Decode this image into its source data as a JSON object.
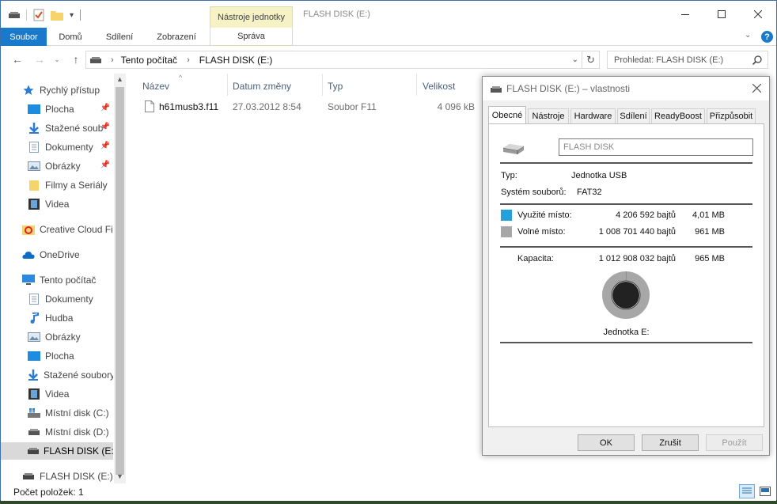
{
  "window": {
    "title": "FLASH DISK (E:)",
    "context_tab": "Nástroje jednotky"
  },
  "ribbon": {
    "tabs": [
      "Soubor",
      "Domů",
      "Sdílení",
      "Zobrazení"
    ],
    "context_subtab": "Správa"
  },
  "address": {
    "path": [
      "Tento počítač",
      "FLASH DISK (E:)"
    ],
    "search_placeholder": "Prohledat: FLASH DISK (E:)"
  },
  "nav": {
    "quick_access": "Rychlý přístup",
    "quick_items": [
      "Plocha",
      "Stažené soub",
      "Dokumenty",
      "Obrázky",
      "Filmy a Seriály",
      "Videa"
    ],
    "creative_cloud": "Creative Cloud Fil",
    "onedrive": "OneDrive",
    "this_pc": "Tento počítač",
    "pc_items": [
      "Dokumenty",
      "Hudba",
      "Obrázky",
      "Plocha",
      "Stažené soubory",
      "Videa",
      "Místní disk (C:)",
      "Místní disk (D:)",
      "FLASH DISK (E:)"
    ],
    "flash_disk": "FLASH DISK (E:)"
  },
  "columns": {
    "name": "Název",
    "date": "Datum změny",
    "type": "Typ",
    "size": "Velikost"
  },
  "files": [
    {
      "name": "h61musb3.f11",
      "date": "27.03.2012 8:54",
      "type": "Soubor F11",
      "size": "4 096 kB"
    }
  ],
  "status": {
    "items_count": "Počet položek: 1"
  },
  "properties": {
    "title": "FLASH DISK (E:) – vlastnosti",
    "tabs": [
      "Obecné",
      "Nástroje",
      "Hardware",
      "Sdílení",
      "ReadyBoost",
      "Přizpůsobit"
    ],
    "label_value": "FLASH DISK",
    "type_label": "Typ:",
    "type_value": "Jednotka USB",
    "fs_label": "Systém souborů:",
    "fs_value": "FAT32",
    "used_label": "Využité místo:",
    "used_bytes": "4 206 592 bajtů",
    "used_human": "4,01 MB",
    "free_label": "Volné místo:",
    "free_bytes": "1 008 701 440 bajtů",
    "free_human": "961 MB",
    "capacity_label": "Kapacita:",
    "capacity_bytes": "1 012 908 032 bajtů",
    "capacity_human": "965 MB",
    "drive_label": "Jednotka E:",
    "used_fraction": 0.0042,
    "used_color": "#26a0da",
    "free_color": "#a7a7a7",
    "btn_ok": "OK",
    "btn_cancel": "Zrušit",
    "btn_apply": "Použít"
  }
}
